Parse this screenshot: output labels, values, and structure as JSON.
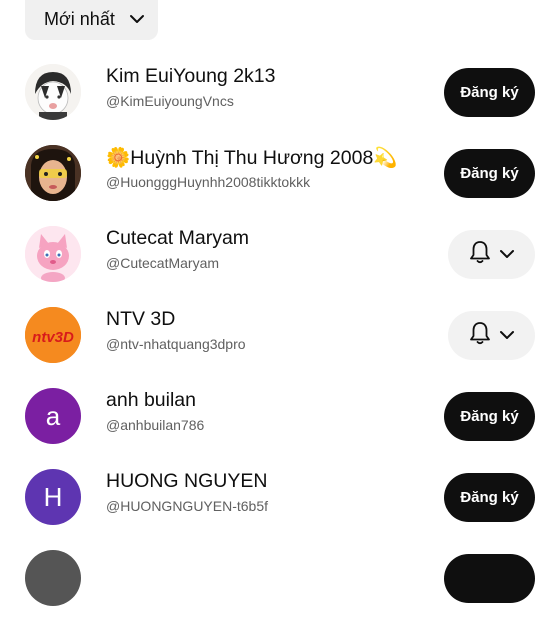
{
  "sort": {
    "label": "Mới nhất",
    "icon": "chevron-down-icon"
  },
  "channels": [
    {
      "name": "Kim EuiYoung 2k13",
      "handle": "@KimEuiyoungVncs",
      "action": "subscribe"
    },
    {
      "name": "🌼Huỳnh Thị Thu Hương 2008💫",
      "handle": "@HuongggHuynhh2008tikktokkk",
      "action": "subscribe"
    },
    {
      "name": "Cutecat Maryam",
      "handle": "@CutecatMaryam",
      "action": "subscribed-bell"
    },
    {
      "name": "NTV 3D",
      "handle": "@ntv-nhatquang3dpro",
      "action": "subscribed-bell",
      "logo_text": "ntv3D"
    },
    {
      "name": "anh builan",
      "handle": "@anhbuilan786",
      "action": "subscribe",
      "avatar_letter": "a",
      "avatar_color": "#7b1fa2"
    },
    {
      "name": "HUONG NGUYEN",
      "handle": "@HUONGNGUYEN-t6b5f",
      "action": "subscribe",
      "avatar_letter": "H",
      "avatar_color": "#5e35b1"
    }
  ],
  "subscribe_label": "Đăng ký",
  "colors": {
    "button_dark": "#0f0f0f",
    "chip_bg": "#f0f0f0",
    "bell_bg": "#f2f2f2",
    "handle_text": "#606060"
  }
}
